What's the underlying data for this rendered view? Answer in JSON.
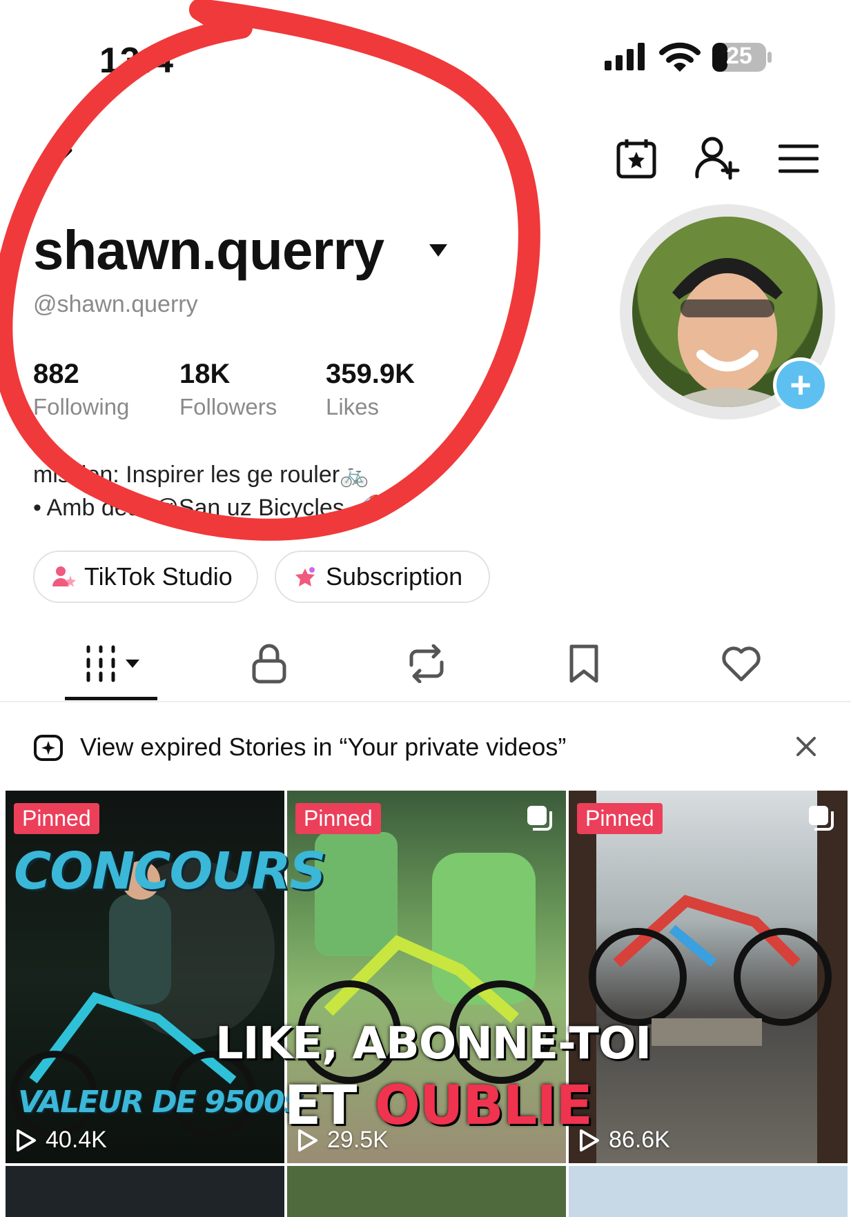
{
  "status_bar": {
    "time": "13:4",
    "battery": "25"
  },
  "profile": {
    "display_name": "shawn.querry",
    "handle": "@shawn.querry",
    "stats": [
      {
        "value": "882",
        "label": "Following"
      },
      {
        "value": "18K",
        "label": "Followers"
      },
      {
        "value": "359.9K",
        "label": "Likes"
      }
    ],
    "bio": [
      "mission: Inspirer les ge       rouler🚲",
      "• Amb            deur @San          uz Bicycles 🚀"
    ]
  },
  "buttons": {
    "studio": "TikTok Studio",
    "subscription": "Subscription"
  },
  "banner": {
    "text": "View expired Stories in “Your private videos”"
  },
  "videos": [
    {
      "pinned": "Pinned",
      "views": "40.4K"
    },
    {
      "pinned": "Pinned",
      "views": "29.5K"
    },
    {
      "pinned": "Pinned",
      "views": "86.6K"
    }
  ],
  "thumbnail_text": {
    "concours": "CONCOURS",
    "valeur": "VALEUR DE 9500$"
  },
  "overlay": {
    "line1": "LIKE, ABONNE-TOI",
    "line2_a": "ET ",
    "line2_b": "OUBLIE"
  },
  "colors": {
    "pinned": "#ec3f5a",
    "accent_blue": "#5ec0f0",
    "annotation_red": "#f0393a"
  },
  "icons": [
    "edit-icon",
    "calendar-star-icon",
    "add-user-icon",
    "menu-icon",
    "grid-icon",
    "lock-icon",
    "repost-icon",
    "bookmark-icon",
    "heart-icon",
    "sparkle-plus-icon",
    "close-icon",
    "play-icon",
    "multi-photo-icon"
  ]
}
